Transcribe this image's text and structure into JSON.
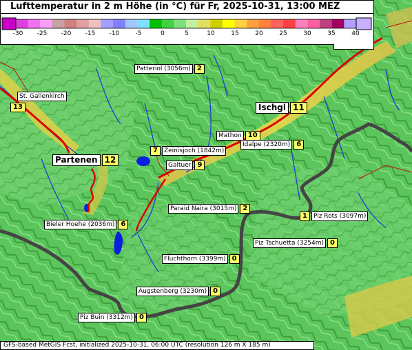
{
  "title": "Lufttemperatur in 2 m Höhe (in °C) für Fr, 2025-10-31, 13:00 MEZ",
  "legend": {
    "ticks": [
      "-30",
      "-25",
      "-20",
      "-15",
      "-10",
      "-5",
      "0",
      "5",
      "10",
      "15",
      "20",
      "25",
      "30",
      "35",
      "40"
    ],
    "colors": [
      "#c800c8",
      "#e040e0",
      "#f070f0",
      "#f8a0f8",
      "#c8a0a0",
      "#d08080",
      "#e0a0a0",
      "#f0c0c0",
      "#a0a0ff",
      "#8080ff",
      "#a0c8ff",
      "#80e0ff",
      "#00c000",
      "#40d040",
      "#80e080",
      "#c0f0a0",
      "#e0e060",
      "#d0d000",
      "#ffff00",
      "#ffd040",
      "#ffa040",
      "#ff8040",
      "#ff6060",
      "#ff4040",
      "#ff80c0",
      "#ff60a0",
      "#c04080",
      "#a00060",
      "#b0a0ff",
      "#c8b0ff"
    ]
  },
  "locations": [
    {
      "id": "patteriol",
      "name": "Patteriol (3056m)",
      "value": "2",
      "big": false
    },
    {
      "id": "st-gallenkirch",
      "name": "St. Gallenkirch",
      "value": "13",
      "big": false
    },
    {
      "id": "ischgl",
      "name": "Ischgl",
      "value": "11",
      "big": true
    },
    {
      "id": "mathon",
      "name": "Mathon",
      "value": "10",
      "big": false
    },
    {
      "id": "idalpe",
      "name": "Idalpe (2320m)",
      "value": "6",
      "big": false
    },
    {
      "id": "zeinisjoch",
      "name": "Zeinisjoch (1842m)",
      "value": "7",
      "big": false
    },
    {
      "id": "partenen",
      "name": "Partenen",
      "value": "12",
      "big": true
    },
    {
      "id": "galtuer",
      "name": "Galtuer",
      "value": "9",
      "big": false
    },
    {
      "id": "paraid-naira",
      "name": "Paraid Naira (3015m)",
      "value": "2",
      "big": false
    },
    {
      "id": "piz-rots",
      "name": "Piz Rots (3097m)",
      "value": "1",
      "big": false
    },
    {
      "id": "bieler-hoehe",
      "name": "Bieler Hoehe (2036m)",
      "value": "6",
      "big": false
    },
    {
      "id": "piz-tschuetta",
      "name": "Piz Tschuetta (3254m)",
      "value": "0",
      "big": false
    },
    {
      "id": "fluchthorn",
      "name": "Fluchthorn (3399m)",
      "value": "0",
      "big": false
    },
    {
      "id": "augstenberg",
      "name": "Augstenberg (3230m)",
      "value": "0",
      "big": false
    },
    {
      "id": "piz-buin",
      "name": "Piz Buin (3312m)",
      "value": "0",
      "big": false
    }
  ],
  "footer": "GFS-based MetGIS Fcst, initialized 2025-10-31, 06:00 UTC  (resolution 126 m X 185 m)"
}
